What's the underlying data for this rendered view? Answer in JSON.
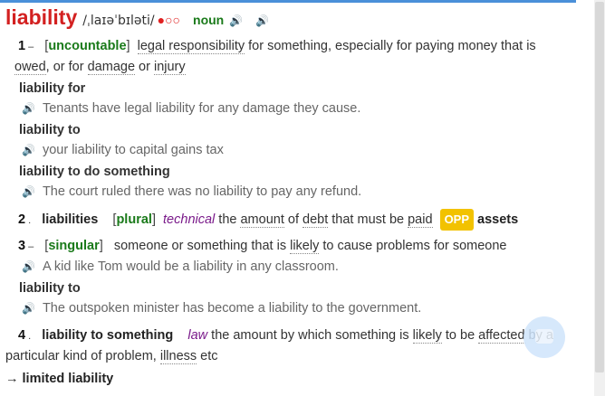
{
  "entry": {
    "headword": "liability",
    "pronunciation": "/ˌlaɪəˈbɪləti/",
    "frequency": "●○○",
    "pos": "noun",
    "speaker_uk_icon": "speaker-red-icon",
    "speaker_us_icon": "speaker-blue-icon"
  },
  "senses": [
    {
      "num": "1",
      "grammar": "uncountable",
      "definition_parts": [
        "legal responsibility",
        " for something, especially for paying money that is ",
        "owed",
        ", or for ",
        "damage",
        " or ",
        "injury"
      ],
      "patterns": [
        {
          "pattern": "liability for",
          "example": "Tenants have legal liability for any damage they cause."
        },
        {
          "pattern": "liability to",
          "example": "your liability to capital gains tax"
        },
        {
          "pattern": "liability to do something",
          "example": "The court ruled there was no liability to pay any refund."
        }
      ]
    },
    {
      "num": "2",
      "phrase": "liabilities",
      "grammar": "plural",
      "label": "technical",
      "definition_parts": [
        "the ",
        "amount",
        " of ",
        "debt",
        " that must be ",
        "paid"
      ],
      "opp_label": "OPP",
      "opposite": "assets"
    },
    {
      "num": "3",
      "grammar": "singular",
      "definition_parts": [
        "someone or something that is ",
        "likely",
        " to cause problems for someone"
      ],
      "example": "A kid like Tom would be a liability in any classroom.",
      "patterns": [
        {
          "pattern": "liability to",
          "example": "The outspoken minister has become a liability to the government."
        }
      ]
    },
    {
      "num": "4",
      "phrase": "liability to something",
      "label": "law",
      "definition_parts": [
        "the amount by which something is ",
        "likely",
        " to be ",
        "affected",
        " by a particular kind of problem, ",
        "illness",
        " etc"
      ]
    }
  ],
  "see_also": "→ limited liability"
}
